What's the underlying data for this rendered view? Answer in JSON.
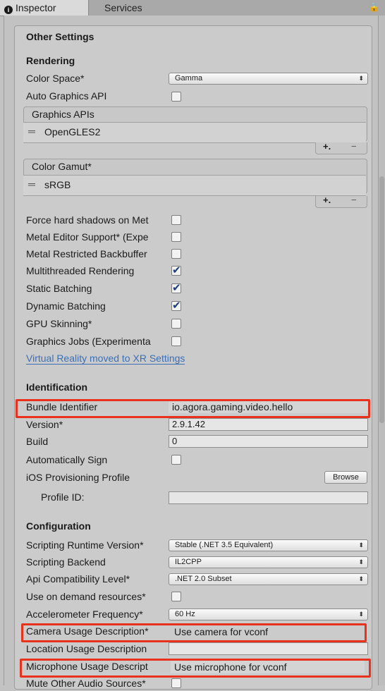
{
  "tabs": {
    "inspector": "Inspector",
    "services": "Services"
  },
  "other_settings": "Other Settings",
  "rendering": {
    "header": "Rendering",
    "color_space_label": "Color Space*",
    "color_space_value": "Gamma",
    "auto_graphics_label": "Auto Graphics API",
    "graphics_apis_title": "Graphics APIs",
    "graphics_apis_item": "OpenGLES2",
    "color_gamut_title": "Color Gamut*",
    "color_gamut_item": "sRGB",
    "plus": "+.",
    "minus": "−",
    "force_hard_shadows": "Force hard shadows on Met",
    "metal_editor_support": "Metal Editor Support* (Expe",
    "metal_restricted": "Metal Restricted Backbuffer",
    "multithreaded": "Multithreaded Rendering",
    "static_batching": "Static Batching",
    "dynamic_batching": "Dynamic Batching",
    "gpu_skinning": "GPU Skinning*",
    "graphics_jobs": "Graphics Jobs (Experimenta",
    "vr_link": "Virtual Reality moved to XR Settings"
  },
  "identification": {
    "header": "Identification",
    "bundle_label": "Bundle Identifier",
    "bundle_value": "io.agora.gaming.video.hello",
    "version_label": "Version*",
    "version_value": "2.9.1.42",
    "build_label": "Build",
    "build_value": "0",
    "auto_sign_label": "Automatically Sign",
    "ios_profile_label": "iOS Provisioning Profile",
    "browse_label": "Browse",
    "profile_id_label": "Profile ID:"
  },
  "configuration": {
    "header": "Configuration",
    "runtime_label": "Scripting Runtime Version*",
    "runtime_value": "Stable (.NET 3.5 Equivalent)",
    "backend_label": "Scripting Backend",
    "backend_value": "IL2CPP",
    "api_label": "Api Compatibility Level*",
    "api_value": ".NET 2.0 Subset",
    "on_demand_label": "Use on demand resources*",
    "accel_label": "Accelerometer Frequency*",
    "accel_value": "60 Hz",
    "camera_label": "Camera Usage Description*",
    "camera_value": "Use camera for vconf",
    "location_label": "Location Usage Description",
    "location_value": "",
    "mic_label": "Microphone Usage Descript",
    "mic_value": "Use microphone for vconf",
    "mute_label": "Mute Other Audio Sources*"
  }
}
